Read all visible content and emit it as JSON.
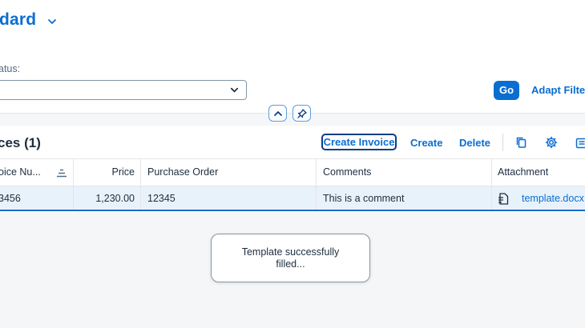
{
  "header": {
    "variant_title": "dard",
    "filter_status_label": "atus:",
    "filter_status_value": "",
    "go_label": "Go",
    "adapt_filters_label": "Adapt Filter"
  },
  "table": {
    "title": "ces (1)",
    "toolbar": {
      "create_invoice_label": "Create Invoice",
      "create_label": "Create",
      "delete_label": "Delete"
    },
    "columns": [
      "oice Nu...",
      "Price",
      "Purchase Order",
      "Comments",
      "Attachment"
    ],
    "rows": [
      {
        "invoice_number": "3456",
        "price": "1,230.00",
        "purchase_order": "12345",
        "comments": "This is a comment",
        "attachment": "template.docx"
      }
    ]
  },
  "toast": {
    "message": "Template successfully filled..."
  },
  "colors": {
    "accent": "#0a6ed1",
    "selected_row": "#e8f2fb",
    "text": "#1d2d3e"
  }
}
